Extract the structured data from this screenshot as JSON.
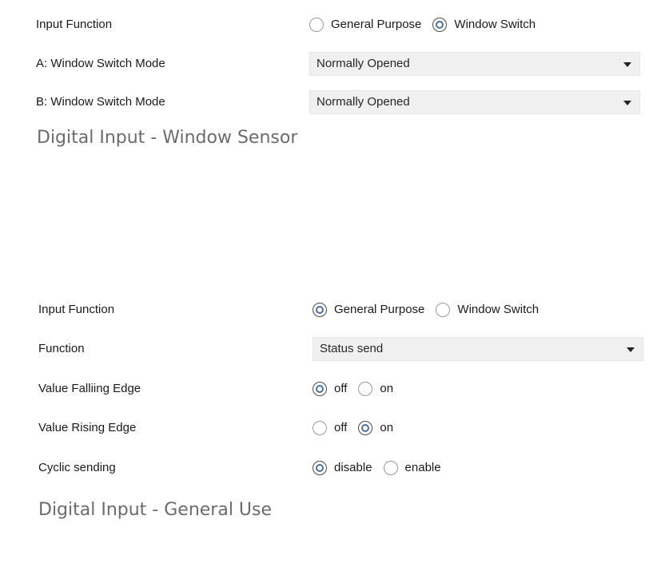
{
  "window_sensor": {
    "input_function": {
      "label": "Input Function",
      "options": [
        {
          "label": "General Purpose",
          "selected": false
        },
        {
          "label": "Window Switch",
          "selected": true
        }
      ]
    },
    "a_mode": {
      "label": "A: Window Switch Mode",
      "value": "Normally Opened"
    },
    "b_mode": {
      "label": "B: Window Switch Mode",
      "value": "Normally Opened"
    },
    "caption": "Digital Input - Window Sensor"
  },
  "general_use": {
    "input_function": {
      "label": "Input Function",
      "options": [
        {
          "label": "General Purpose",
          "selected": true
        },
        {
          "label": "Window Switch",
          "selected": false
        }
      ]
    },
    "function": {
      "label": "Function",
      "value": "Status send"
    },
    "falling_edge": {
      "label": "Value Falliing Edge",
      "options": [
        {
          "label": "off",
          "selected": true
        },
        {
          "label": "on",
          "selected": false
        }
      ]
    },
    "rising_edge": {
      "label": "Value Rising Edge",
      "options": [
        {
          "label": "off",
          "selected": false
        },
        {
          "label": "on",
          "selected": true
        }
      ]
    },
    "cyclic": {
      "label": "Cyclic sending",
      "options": [
        {
          "label": "disable",
          "selected": true
        },
        {
          "label": "enable",
          "selected": false
        }
      ]
    },
    "caption": "Digital Input - General Use"
  },
  "colors": {
    "radio_dot": "#4a6fa5",
    "select_bg": "#f0f0f0",
    "caption_text": "#6b6b6b"
  }
}
